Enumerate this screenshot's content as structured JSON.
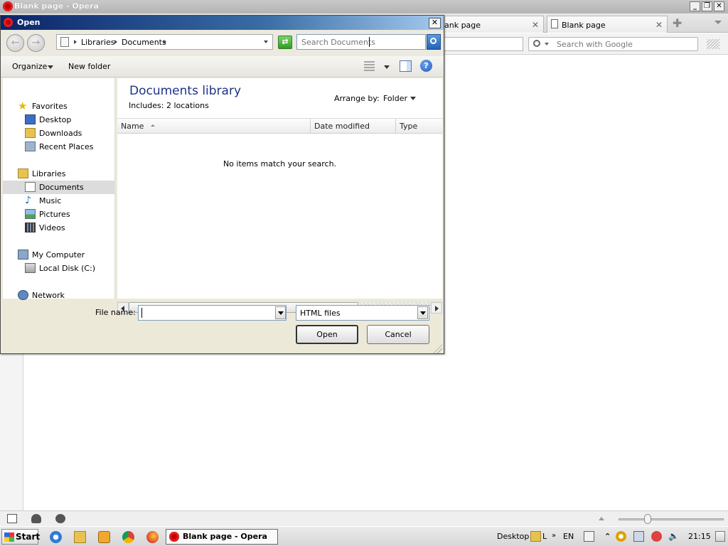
{
  "opera": {
    "window_title": "Blank page - Opera",
    "tabs": [
      {
        "label": "ank page"
      },
      {
        "label": "Blank page"
      }
    ],
    "search_placeholder": "Search with Google"
  },
  "dialog": {
    "title": "Open",
    "breadcrumb": [
      "Libraries",
      "Documents"
    ],
    "search_placeholder": "Search Documents",
    "toolbar": {
      "organize": "Organize",
      "new_folder": "New folder"
    },
    "nav": {
      "favorites": "Favorites",
      "desktop": "Desktop",
      "downloads": "Downloads",
      "recent_places": "Recent Places",
      "libraries": "Libraries",
      "documents": "Documents",
      "music": "Music",
      "pictures": "Pictures",
      "videos": "Videos",
      "my_computer": "My Computer",
      "local_disk": "Local Disk (C:)",
      "network": "Network"
    },
    "library_title": "Documents library",
    "library_subtitle": "Includes:  2 locations",
    "arrange_by_label": "Arrange by:",
    "arrange_by_value": "Folder",
    "columns": [
      "Name",
      "Date modified",
      "Type"
    ],
    "empty_message": "No items match your search.",
    "file_name_label": "File name:",
    "file_name_value": "",
    "file_type": "HTML files",
    "open_label": "Open",
    "cancel_label": "Cancel"
  },
  "taskbar": {
    "start_label": "Start",
    "active_task": "Blank page - Opera",
    "desktop_label": "Desktop",
    "lang": "EN",
    "clock": "21:15"
  },
  "colors": {
    "dialog_title_start": "#0a246a",
    "dialog_title_end": "#a6caf0",
    "library_title": "#1e3287",
    "selected_nav": "#dcdcdc"
  }
}
